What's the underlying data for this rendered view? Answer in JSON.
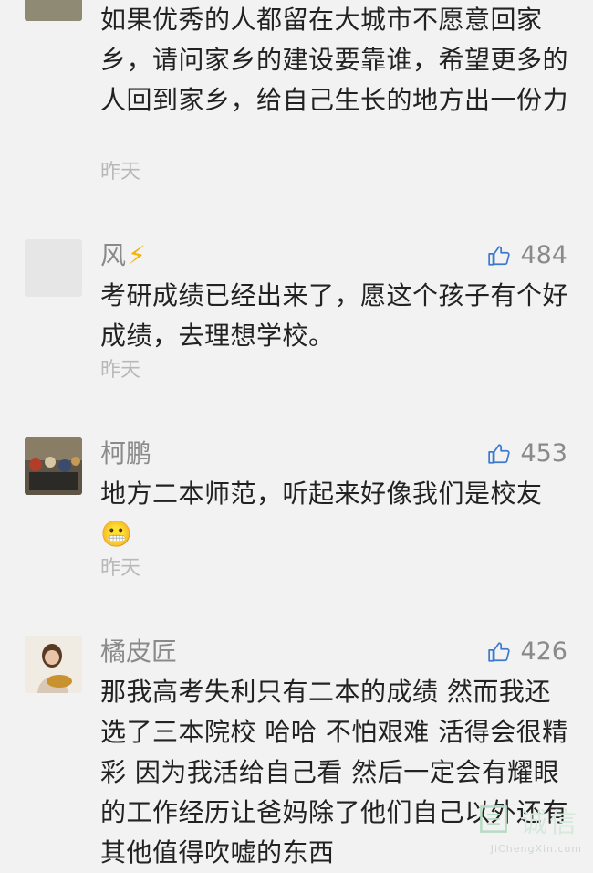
{
  "comments": [
    {
      "name": "",
      "likes": "",
      "text": "如果优秀的人都留在大城市不愿意回家乡，请问家乡的建设要靠谁，希望更多的人回到家乡，给自己生长的地方出一份力",
      "time": "昨天"
    },
    {
      "name": "风",
      "name_emoji": "⚡",
      "likes": "484",
      "text": "考研成绩已经出来了，愿这个孩子有个好成绩，去理想学校。",
      "time": "昨天"
    },
    {
      "name": "柯鹏",
      "likes": "453",
      "text": "地方二本师范，听起来好像我们是校友",
      "emoji": "😬",
      "time": "昨天"
    },
    {
      "name": "橘皮匠",
      "likes": "426",
      "text": "那我高考失利只有二本的成绩 然而我还选了三本院校 哈哈 不怕艰难 活得会很精彩 因为我活给自己看 然后一定会有耀眼的工作经历让爸妈除了他们自己以外还有其他值得吹嘘的东西",
      "time": ""
    }
  ],
  "watermark": {
    "text": "诚信",
    "sub": "JiChengXin.com"
  },
  "colors": {
    "background": "#f2f2f2",
    "text": "#222222",
    "meta": "#8a8a8a",
    "time": "#b8b8b8"
  }
}
